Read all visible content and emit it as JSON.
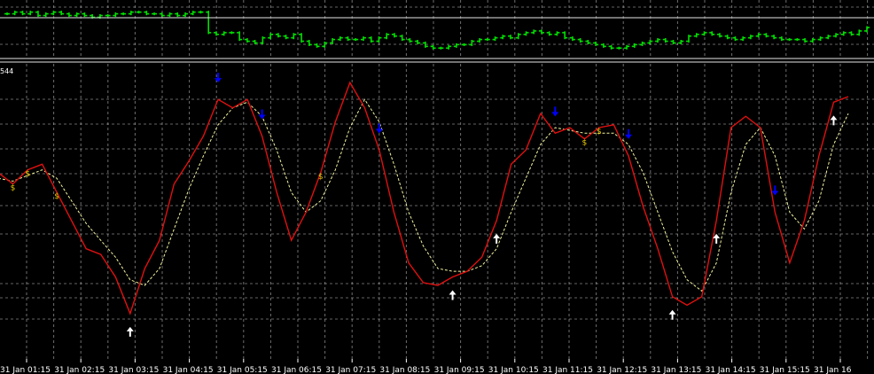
{
  "colors": {
    "background": "#000000",
    "grid": "#c8c8c8",
    "separator": "#e6e6e6",
    "price_bars": "#00e000",
    "main_line": "#e01010",
    "signal_line": "#f4f4a0",
    "sell_arrow": "#0000ff",
    "buy_arrow": "#ffffff",
    "cross_marker": "#e6c800"
  },
  "icons": {
    "sell": "down-arrow-icon",
    "buy": "up-arrow-icon",
    "cross": "dollar-marker-icon"
  },
  "indicator": {
    "label_fragment": "544"
  },
  "chart_data": [
    {
      "type": "ohlc",
      "panel": "price",
      "x": [
        "31 Jan 01:15",
        "31 Jan 02:15",
        "31 Jan 03:15",
        "31 Jan 04:15",
        "31 Jan 05:15",
        "31 Jan 06:15",
        "31 Jan 07:15",
        "31 Jan 08:15",
        "31 Jan 09:15",
        "31 Jan 10:15",
        "31 Jan 11:15",
        "31 Jan 12:15",
        "31 Jan 13:15",
        "31 Jan 14:15",
        "31 Jan 15:15",
        "31 Jan 16"
      ],
      "values": [
        24,
        25,
        24,
        25,
        23,
        24,
        25,
        24,
        23,
        24,
        23,
        22,
        23,
        23,
        24,
        24,
        25,
        25,
        24,
        24,
        23,
        24,
        23,
        24,
        25,
        25,
        13,
        12,
        13,
        13,
        9,
        8,
        7,
        10,
        12,
        11,
        10,
        12,
        8,
        6,
        5,
        7,
        9,
        10,
        9,
        9,
        10,
        8,
        10,
        12,
        11,
        9,
        8,
        7,
        5,
        4,
        4,
        5,
        6,
        6,
        8,
        9,
        9,
        10,
        11,
        10,
        12,
        13,
        14,
        13,
        12,
        13,
        10,
        9,
        8,
        7,
        6,
        5,
        4,
        4,
        5,
        6,
        7,
        8,
        9,
        8,
        7,
        8,
        11,
        12,
        13,
        12,
        11,
        10,
        9,
        10,
        11,
        12,
        11,
        10,
        9,
        9,
        9,
        8,
        9,
        10,
        11,
        12,
        13,
        12,
        14,
        16
      ],
      "ylim": [
        0,
        30
      ]
    },
    {
      "type": "line",
      "panel": "indicator",
      "x": [
        "31 Jan 01:15",
        "31 Jan 02:15",
        "31 Jan 03:15",
        "31 Jan 04:15",
        "31 Jan 05:15",
        "31 Jan 06:15",
        "31 Jan 07:15",
        "31 Jan 08:15",
        "31 Jan 09:15",
        "31 Jan 10:15",
        "31 Jan 11:15",
        "31 Jan 12:15",
        "31 Jan 13:15",
        "31 Jan 14:15",
        "31 Jan 15:15",
        "31 Jan 16"
      ],
      "ylim": [
        0,
        100
      ],
      "series": [
        {
          "values": [
            62,
            58,
            63,
            65,
            55,
            45,
            35,
            33,
            25,
            12,
            28,
            38,
            58,
            66,
            75,
            88,
            85,
            88,
            75,
            55,
            38,
            48,
            62,
            80,
            94,
            85,
            70,
            48,
            30,
            23,
            22,
            25,
            27,
            32,
            45,
            65,
            70,
            83,
            76,
            78,
            74,
            78,
            79,
            68,
            50,
            35,
            18,
            15,
            18,
            45,
            78,
            82,
            78,
            48,
            30,
            45,
            68,
            87,
            89
          ]
        },
        {
          "values": [
            60,
            59,
            61,
            63,
            60,
            52,
            44,
            38,
            32,
            24,
            22,
            28,
            42,
            56,
            68,
            79,
            85,
            87,
            82,
            70,
            55,
            48,
            52,
            63,
            78,
            88,
            80,
            65,
            48,
            36,
            28,
            27,
            27,
            29,
            35,
            48,
            60,
            72,
            78,
            77,
            76,
            76,
            76,
            72,
            62,
            48,
            34,
            24,
            20,
            30,
            55,
            72,
            78,
            68,
            48,
            42,
            52,
            72,
            83
          ]
        }
      ],
      "signals": {
        "sell": [
          15,
          18,
          26,
          38,
          43,
          53
        ],
        "buy": [
          9,
          31,
          34,
          46,
          49,
          57
        ],
        "cross": [
          1,
          2,
          4,
          22,
          40,
          41
        ]
      }
    }
  ]
}
